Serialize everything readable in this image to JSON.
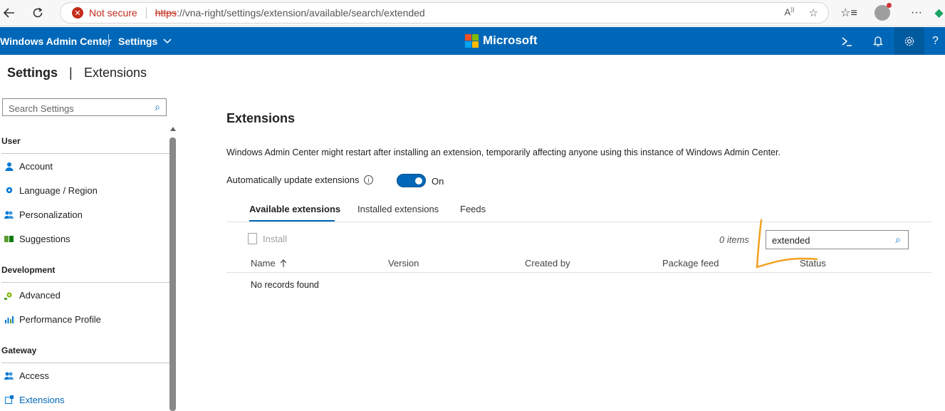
{
  "browser": {
    "security_label": "Not secure",
    "url_scheme": "https",
    "url_rest": "://vna-right/settings/extension/available/search/extended",
    "back_icon": "back-arrow-icon",
    "refresh_icon": "refresh-icon"
  },
  "app_header": {
    "title": "Windows Admin Center",
    "settings_menu": "Settings",
    "brand": "Microsoft",
    "brand_colors": [
      "#f25022",
      "#7fba00",
      "#00a4ef",
      "#ffb900"
    ],
    "accent": "#0067b8"
  },
  "page": {
    "title": "Settings",
    "divider": "|",
    "subtitle": "Extensions"
  },
  "sidebar": {
    "search_placeholder": "Search Settings",
    "groups": [
      {
        "label": "User",
        "items": [
          {
            "label": "Account",
            "icon": "person-icon"
          },
          {
            "label": "Language / Region",
            "icon": "gear-icon"
          },
          {
            "label": "Personalization",
            "icon": "people-icon"
          },
          {
            "label": "Suggestions",
            "icon": "suggestions-icon"
          }
        ]
      },
      {
        "label": "Development",
        "items": [
          {
            "label": "Advanced",
            "icon": "advanced-icon"
          },
          {
            "label": "Performance Profile",
            "icon": "chart-icon"
          }
        ]
      },
      {
        "label": "Gateway",
        "items": [
          {
            "label": "Access",
            "icon": "people-icon"
          },
          {
            "label": "Extensions",
            "icon": "extension-icon",
            "selected": true
          }
        ]
      }
    ]
  },
  "main": {
    "heading": "Extensions",
    "description": "Windows Admin Center might restart after installing an extension, temporarily affecting anyone using this instance of Windows Admin Center.",
    "auto_update_label": "Automatically update extensions",
    "auto_update_state": "On",
    "tabs": [
      "Available extensions",
      "Installed extensions",
      "Feeds"
    ],
    "active_tab": 0,
    "install_label": "Install",
    "items_count": "0 items",
    "search_value": "extended",
    "columns": [
      "Name",
      "Version",
      "Created by",
      "Package feed",
      "Status"
    ],
    "empty_message": "No records found"
  }
}
